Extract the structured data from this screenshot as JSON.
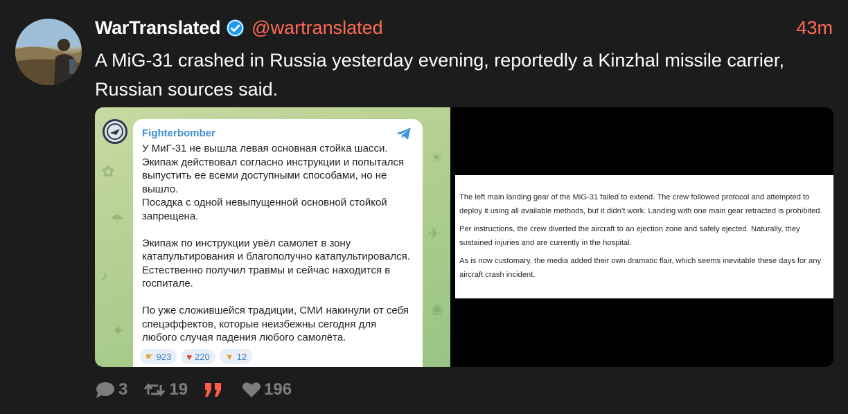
{
  "tweet": {
    "author_name": "WarTranslated",
    "handle": "@wartranslated",
    "time_ago": "43m",
    "text": "A MiG-31 crashed in Russia yesterday evening, reportedly a Kinzhal missile carrier, Russian sources said."
  },
  "telegram_post": {
    "channel": "Fighterbomber",
    "paragraphs": [
      "У МиГ-31 не вышла левая основная стойка шасси. Экипаж действовал согласно инструкции и попытался выпустить ее всеми доступными способами, но не вышло.\nПосадка с одной невыпущенной основной стойкой запрещена.",
      "Экипаж по инструкции увёл самолет в зону катапультирования и благополучно катапультировался. Естественно получил травмы и сейчас находится в госпитале.",
      "По уже сложившейся традиции, СМИ накинули от себя спецэффектов, которые неизбежны сегодня для любого случая падения любого самолёта."
    ],
    "reactions": [
      {
        "icon": "hand-point-icon",
        "count": "923"
      },
      {
        "icon": "heart-icon",
        "count": "220"
      },
      {
        "icon": "thumbs-down-icon",
        "count": "12"
      }
    ]
  },
  "translation": {
    "paragraphs": [
      "The left main landing gear of the MiG-31 failed to extend. The crew followed protocol and attempted to deploy it using all available methods, but it didn’t work. Landing with one main gear retracted is prohibited.",
      "Per instructions, the crew diverted the aircraft to an ejection zone and safely ejected. Naturally, they sustained injuries and are currently in the hospital.",
      "As is now customary, the media added their own dramatic flair, which seems inevitable these days for any aircraft crash incident."
    ]
  },
  "actions": {
    "replies": "3",
    "retweets": "19",
    "likes": "196"
  },
  "colors": {
    "accent": "#ff6a55",
    "verified": "#1d9bf0",
    "muted": "#7d7d7d"
  }
}
